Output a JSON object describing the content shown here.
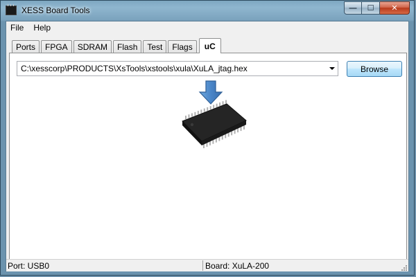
{
  "window": {
    "title": "XESS Board Tools",
    "controls": {
      "minimize": "—",
      "maximize": "☐",
      "close": "✕"
    }
  },
  "menu": {
    "items": [
      "File",
      "Help"
    ]
  },
  "tabs": [
    "Ports",
    "FPGA",
    "SDRAM",
    "Flash",
    "Test",
    "Flags",
    "uC"
  ],
  "active_tab": "uC",
  "uc_panel": {
    "file_path": "C:\\xesscorp\\PRODUCTS\\XsTools\\xstools\\xula\\XuLA_jtag.hex",
    "browse_label": "Browse",
    "arrow_icon": "down-arrow-icon",
    "chip_icon": "microcontroller-chip-icon"
  },
  "status": {
    "port": "Port: USB0",
    "board": "Board: XuLA-200"
  },
  "colors": {
    "arrow_blue": "#4a86c8",
    "chip_body": "#1e1e1e",
    "chip_pins": "#b0b0b0"
  }
}
